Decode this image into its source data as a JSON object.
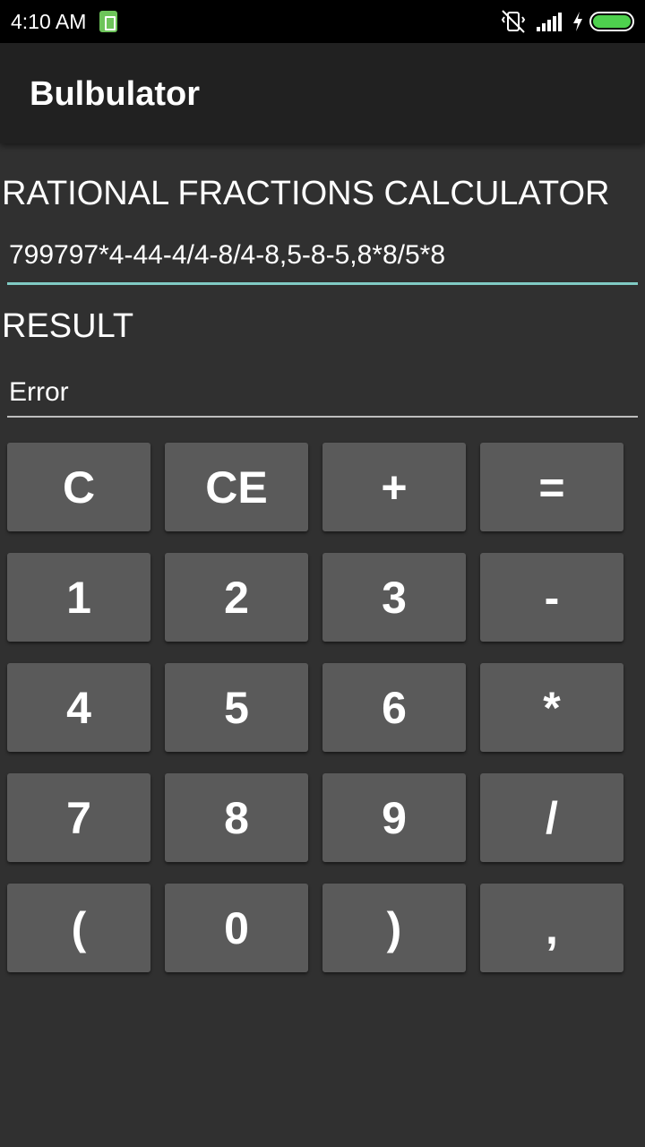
{
  "status_bar": {
    "time": "4:10 AM",
    "battery_saver_icon": "battery-saver-icon",
    "vibrate_icon": "vibrate-icon",
    "signal_icon": "signal-icon",
    "charging_icon": "charging-bolt-icon",
    "battery_level": 1.0,
    "battery_color": "#4ed14e"
  },
  "app_bar": {
    "title": "Bulbulator",
    "background": "#212121"
  },
  "calculator": {
    "heading": "RATIONAL FRACTIONS CALCULATOR",
    "expression": "799797*4-44-4/4-8/4-8,5-8-5,8*8/5*8",
    "accent_color": "#80cbc4"
  },
  "result": {
    "heading": "RESULT",
    "value": "Error"
  },
  "keypad": {
    "keys": [
      {
        "label": "C",
        "name": "key-clear"
      },
      {
        "label": "CE",
        "name": "key-clear-entry"
      },
      {
        "label": "+",
        "name": "key-plus"
      },
      {
        "label": "=",
        "name": "key-equals"
      },
      {
        "label": "1",
        "name": "key-1"
      },
      {
        "label": "2",
        "name": "key-2"
      },
      {
        "label": "3",
        "name": "key-3"
      },
      {
        "label": "-",
        "name": "key-minus"
      },
      {
        "label": "4",
        "name": "key-4"
      },
      {
        "label": "5",
        "name": "key-5"
      },
      {
        "label": "6",
        "name": "key-6"
      },
      {
        "label": "*",
        "name": "key-multiply"
      },
      {
        "label": "7",
        "name": "key-7"
      },
      {
        "label": "8",
        "name": "key-8"
      },
      {
        "label": "9",
        "name": "key-9"
      },
      {
        "label": "/",
        "name": "key-divide"
      },
      {
        "label": "(",
        "name": "key-open-paren"
      },
      {
        "label": "0",
        "name": "key-0"
      },
      {
        "label": ")",
        "name": "key-close-paren"
      },
      {
        "label": ",",
        "name": "key-comma"
      }
    ]
  }
}
